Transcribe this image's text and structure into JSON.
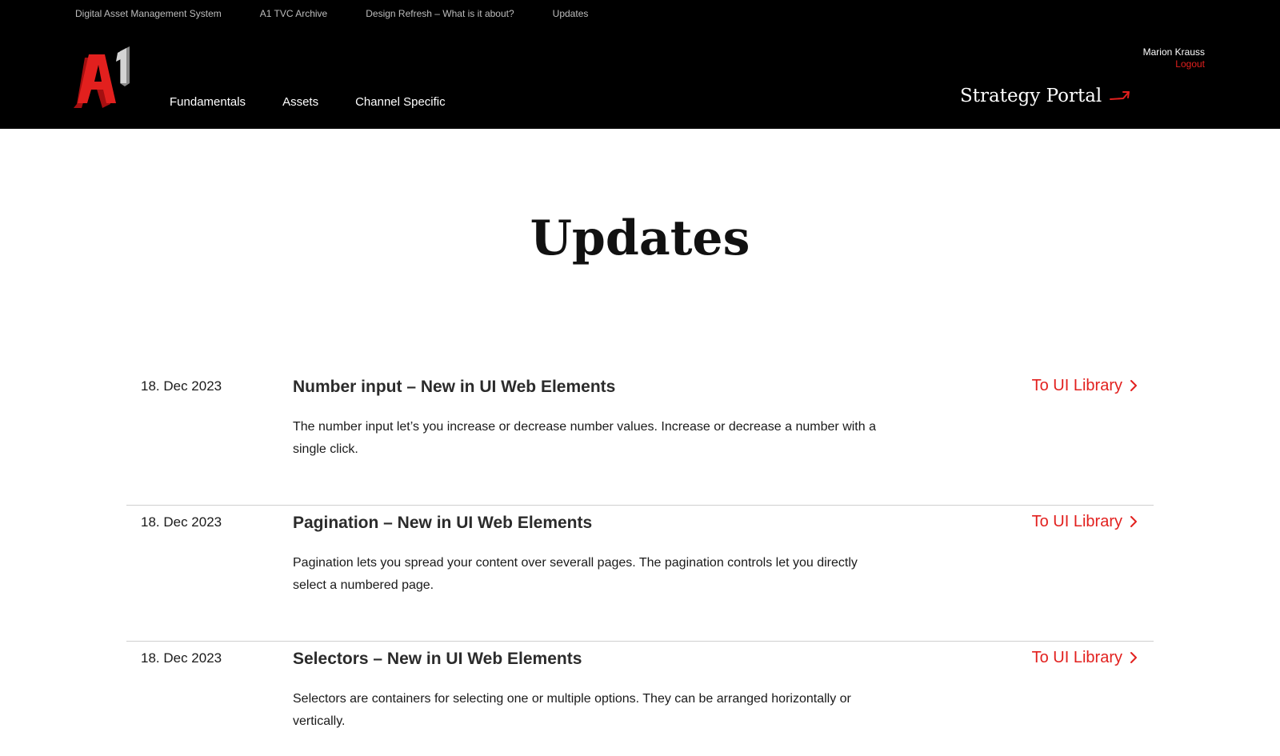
{
  "top_nav": {
    "items": [
      {
        "label": "Digital Asset Management System"
      },
      {
        "label": "A1 TVC Archive"
      },
      {
        "label": "Design Refresh – What is it about?"
      },
      {
        "label": "Updates"
      }
    ]
  },
  "brand": {
    "logo_icon": "a1-logo",
    "accent_color": "#e2201e",
    "header_bg": "#000000"
  },
  "main_nav": {
    "items": [
      {
        "label": "Fundamentals"
      },
      {
        "label": "Assets"
      },
      {
        "label": "Channel Specific"
      }
    ]
  },
  "user": {
    "name": "Marion Krauss",
    "logout_label": "Logout"
  },
  "portal": {
    "label": "Strategy Portal",
    "icon": "arrow-up-right-icon"
  },
  "page": {
    "title": "Updates"
  },
  "updates": [
    {
      "date": "18. Dec 2023",
      "title": "Number input – New in UI Web Elements",
      "description": "The number input let’s you increase or decrease number values. Increase or decrease a number with a single click.",
      "link_label": "To UI Library",
      "link_icon": "chevron-right-icon"
    },
    {
      "date": "18. Dec 2023",
      "title": "Pagination – New in UI Web Elements",
      "description": "Pagination lets you spread your content over severall pages. The pagination controls let you directly select a numbered page.",
      "link_label": "To UI Library",
      "link_icon": "chevron-right-icon"
    },
    {
      "date": "18. Dec 2023",
      "title": "Selectors – New in UI Web Elements",
      "description": "Selectors are containers for selecting one or multiple options. They can be arranged horizontally or vertically.",
      "link_label": "To UI Library",
      "link_icon": "chevron-right-icon"
    }
  ]
}
